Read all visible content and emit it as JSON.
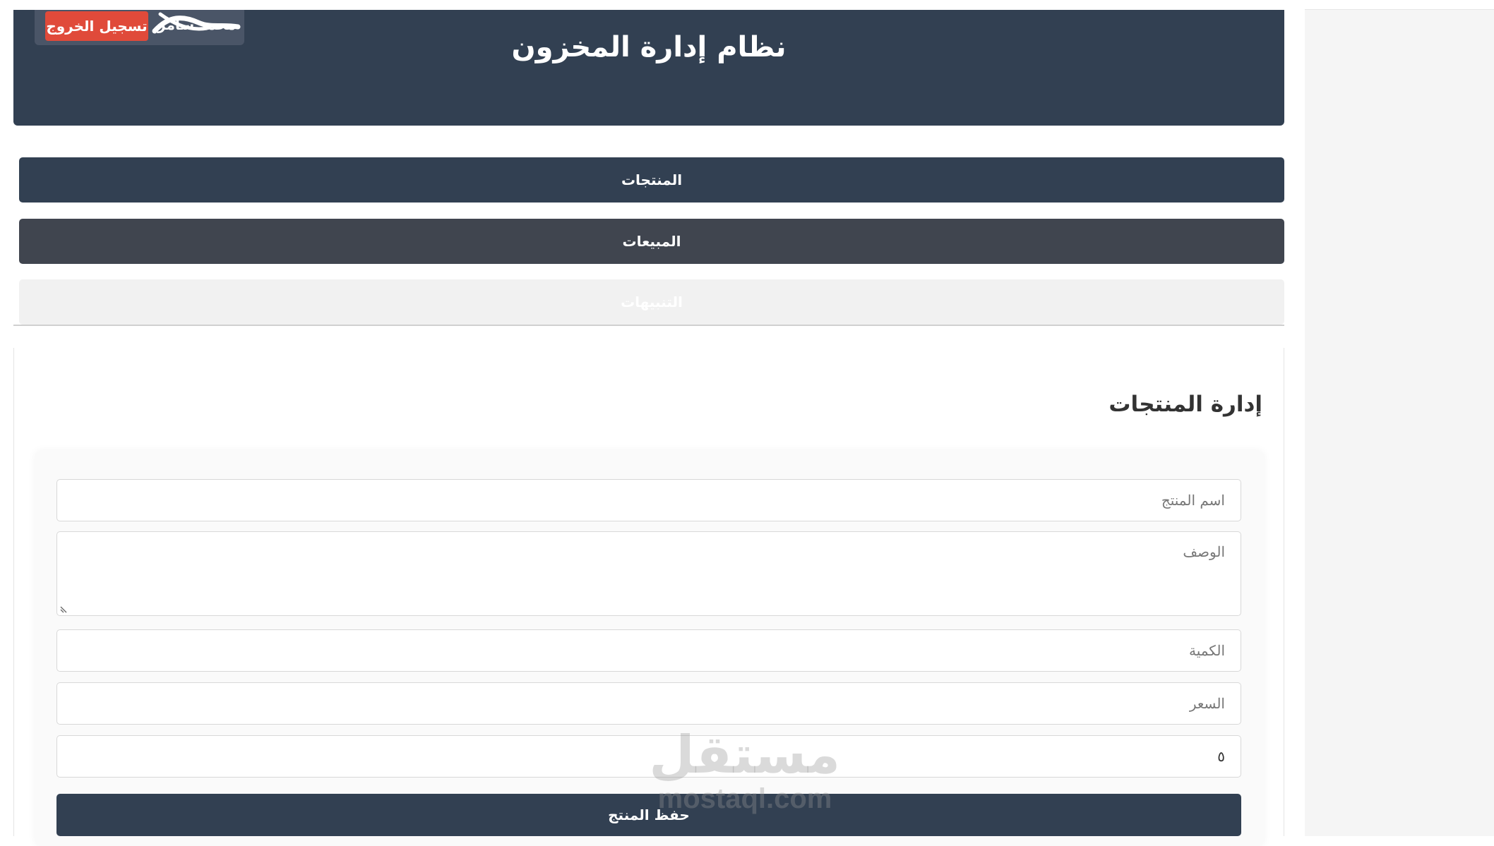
{
  "header": {
    "title": "نظام إدارة المخزون",
    "username": "محمد سامر",
    "logout_label": "تسجيل الخروج"
  },
  "nav": {
    "products": "المنتجات",
    "sales": "المبيعات",
    "alerts": "التنبيهات"
  },
  "section": {
    "title": "إدارة المنتجات"
  },
  "form": {
    "name_placeholder": "اسم المنتج",
    "description_placeholder": "الوصف",
    "quantity_placeholder": "الكمية",
    "price_placeholder": "السعر",
    "code_value": "٥",
    "save_label": "حفظ المنتج"
  },
  "watermark": {
    "arabic": "مستقل",
    "latin": "mostaql.com"
  },
  "colors": {
    "header": "#324052",
    "logout": "#e04a3a",
    "sales_tab": "#40454f",
    "alerts_tab": "#f1f1f1"
  }
}
